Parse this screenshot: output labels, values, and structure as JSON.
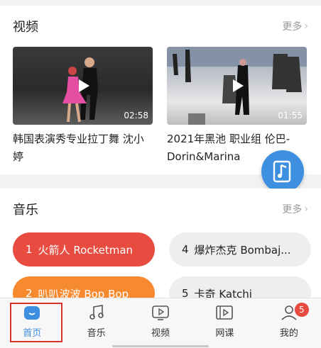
{
  "video_section": {
    "title": "视频",
    "more": "更多",
    "items": [
      {
        "title": "韩国表演秀专业拉丁舞 沈小婷",
        "duration": "02:58"
      },
      {
        "title": "2021年黑池 职业组 伦巴-Dorin&Marina",
        "duration": "01:55"
      }
    ]
  },
  "music_section": {
    "title": "音乐",
    "more": "更多",
    "items": [
      {
        "num": "1",
        "label": "火箭人 Rocketman",
        "color": "#e84b3f"
      },
      {
        "num": "4",
        "label": "爆炸杰克 Bombaj...",
        "color": "#eeeeee"
      },
      {
        "num": "2",
        "label": "叭叭波波 Bop Bop",
        "color": "#f78a2f"
      },
      {
        "num": "5",
        "label": "卡奇 Katchi",
        "color": "#eeeeee"
      }
    ]
  },
  "tabbar": {
    "home": "首页",
    "music": "音乐",
    "video": "视频",
    "course": "网课",
    "mine": "我的",
    "mine_badge": "5"
  },
  "colors": {
    "accent": "#3d8fe0",
    "highlight": "#d9322b"
  },
  "icons": [
    "home-icon",
    "music-note-icon",
    "video-play-icon",
    "course-icon",
    "user-icon",
    "play-icon",
    "chevron-right-icon",
    "music-float-icon"
  ]
}
